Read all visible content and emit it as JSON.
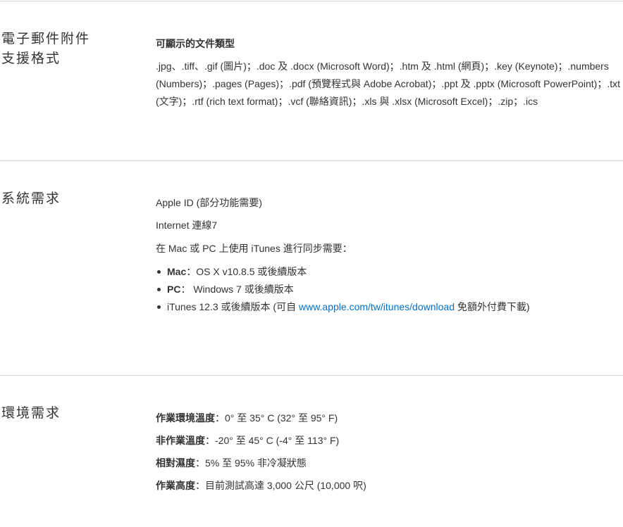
{
  "email": {
    "title_line1": "電子郵件附件",
    "title_line2": "支援格式",
    "subheading": "可顯示的文件類型",
    "formats": ".jpg、.tiff、.gif (圖片)；.doc 及 .docx (Microsoft Word)；.htm 及 .html (網頁)；.key (Keynote)；.numbers (Numbers)；.pages (Pages)；.pdf (預覽程式與 Adobe Acrobat)；.ppt 及 .pptx (Microsoft PowerPoint)；.txt (文字)；.rtf (rich text format)；.vcf (聯絡資訊)；.xls 與 .xlsx (Microsoft Excel)；.zip；.ics"
  },
  "system": {
    "title": "系統需求",
    "apple_id": "Apple ID (部分功能需要)",
    "internet": "Internet 連線7",
    "sync_intro": "在 Mac 或 PC 上使用 iTunes 進行同步需要：",
    "mac_label": "Mac",
    "mac_value": "：OS X v10.8.5 或後續版本",
    "pc_label": "PC",
    "pc_value": "： Windows 7 或後續版本",
    "itunes_prefix": "iTunes 12.3 或後續版本 (可自 ",
    "itunes_link": "www.apple.com/tw/itunes/download",
    "itunes_suffix": " 免額外付費下載)"
  },
  "environment": {
    "title": "環境需求",
    "rows": [
      {
        "label": "作業環境溫度",
        "value": "：0° 至 35° C (32° 至 95° F)"
      },
      {
        "label": "非作業溫度",
        "value": "：-20° 至 45° C (-4° 至 113° F)"
      },
      {
        "label": "相對濕度",
        "value": "：5% 至 95% 非冷凝狀態"
      },
      {
        "label": "作業高度",
        "value": "：目前測試高達 3,000 公尺 (10,000 呎)"
      }
    ]
  }
}
